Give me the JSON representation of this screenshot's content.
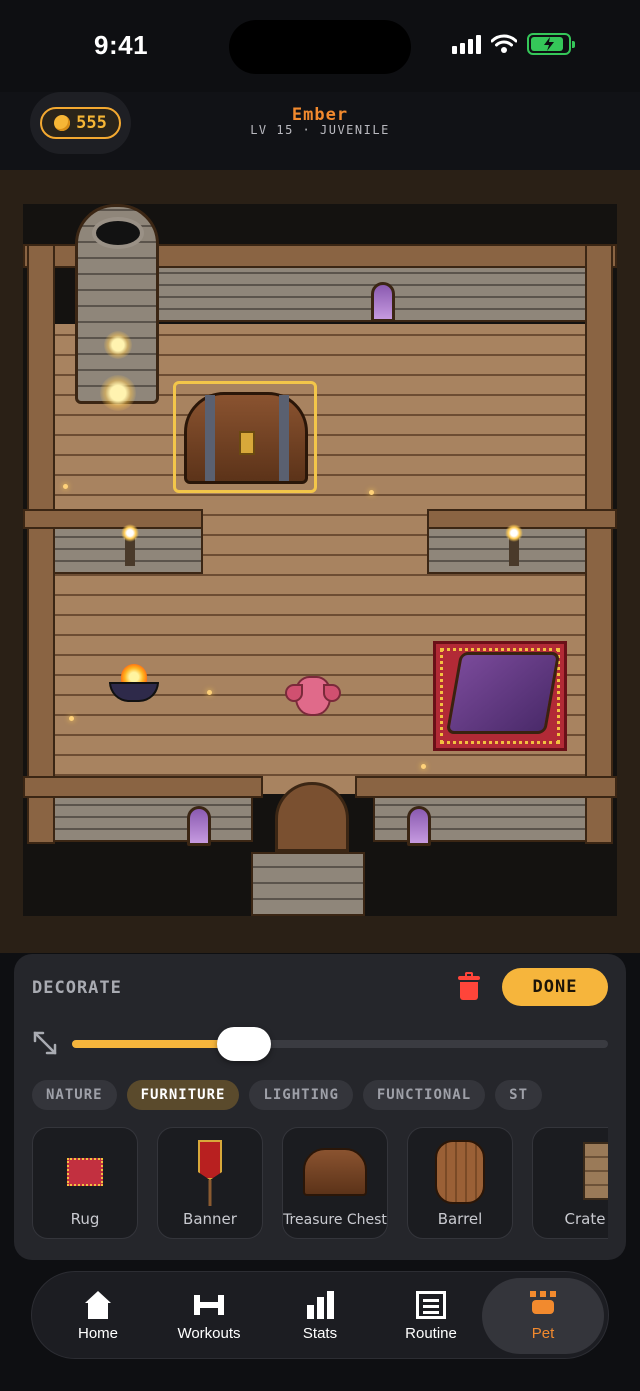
{
  "status_bar": {
    "time": "9:41"
  },
  "header": {
    "coins": "555",
    "pet_name": "Ember",
    "pet_subtitle": "LV 15 · JUVENILE"
  },
  "decorate": {
    "title": "DECORATE",
    "done_label": "DONE",
    "size_slider_fraction": 0.32,
    "categories": [
      "NATURE",
      "FURNITURE",
      "LIGHTING",
      "FUNCTIONAL",
      "ST"
    ],
    "active_category": "FURNITURE",
    "items": [
      "Rug",
      "Banner",
      "Treasure Chest",
      "Barrel",
      "Crate"
    ]
  },
  "tabs": [
    {
      "label": "Home",
      "icon": "home-icon"
    },
    {
      "label": "Workouts",
      "icon": "dumbbell-icon"
    },
    {
      "label": "Stats",
      "icon": "bar-chart-icon"
    },
    {
      "label": "Routine",
      "icon": "list-icon"
    },
    {
      "label": "Pet",
      "icon": "paw-icon"
    }
  ],
  "active_tab": "Pet",
  "colors": {
    "accent": "#f6b53c",
    "pet_name": "#f28a2e",
    "delete": "#ff453a",
    "battery": "#35c759"
  }
}
